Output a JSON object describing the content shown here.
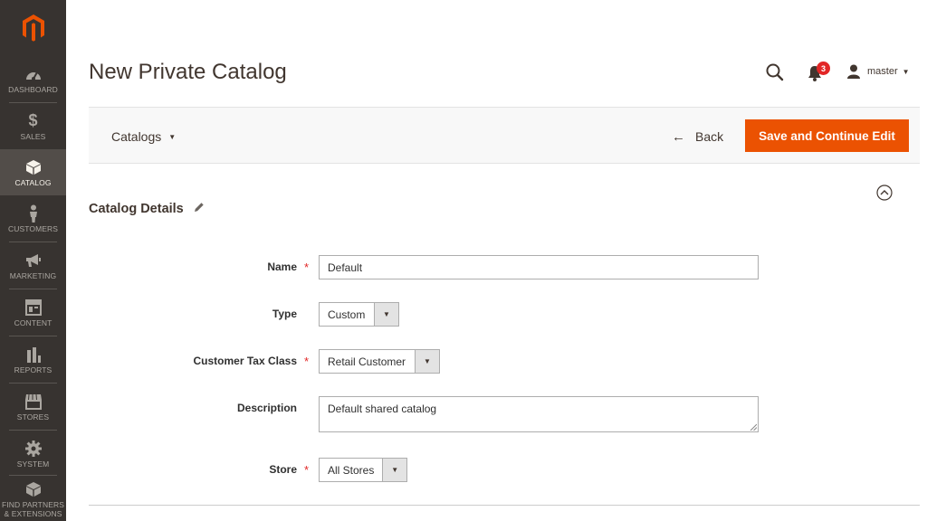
{
  "sidebar": {
    "items": [
      {
        "label": "DASHBOARD",
        "icon": "dashboard-icon"
      },
      {
        "label": "SALES",
        "icon": "dollar-icon"
      },
      {
        "label": "CATALOG",
        "icon": "box-icon",
        "active": true
      },
      {
        "label": "CUSTOMERS",
        "icon": "person-icon"
      },
      {
        "label": "MARKETING",
        "icon": "megaphone-icon"
      },
      {
        "label": "CONTENT",
        "icon": "layout-icon"
      },
      {
        "label": "REPORTS",
        "icon": "bar-chart-icon"
      },
      {
        "label": "STORES",
        "icon": "storefront-icon"
      },
      {
        "label": "SYSTEM",
        "icon": "gear-icon"
      },
      {
        "label": "FIND PARTNERS & EXTENSIONS",
        "icon": "puzzle-box-icon"
      }
    ]
  },
  "header": {
    "title": "New Private Catalog",
    "notification_count": "3",
    "user_name": "master"
  },
  "actions": {
    "scope_label": "Catalogs",
    "back_label": "Back",
    "save_label": "Save and Continue Edit"
  },
  "section": {
    "title": "Catalog Details"
  },
  "form": {
    "name": {
      "label": "Name",
      "value": "Default",
      "required": true
    },
    "type": {
      "label": "Type",
      "value": "Custom",
      "required": false
    },
    "tax_class": {
      "label": "Customer Tax Class",
      "value": "Retail Customer",
      "required": true
    },
    "description": {
      "label": "Description",
      "value": "Default shared catalog",
      "required": false
    },
    "store": {
      "label": "Store",
      "value": "All Stores",
      "required": true
    }
  },
  "colors": {
    "sidebar_bg": "#373330",
    "sidebar_active": "#524d49",
    "accent": "#eb5202",
    "logo": "#eb5202",
    "required": "#e22626"
  }
}
